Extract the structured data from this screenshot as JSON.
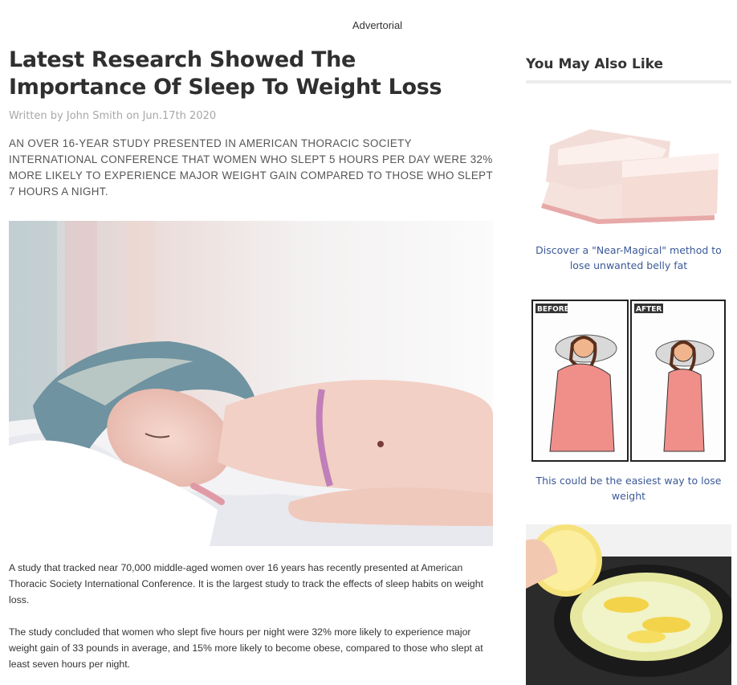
{
  "advertorial_label": "Advertorial",
  "article": {
    "title": "Latest Research Showed The Importance Of Sleep To Weight Loss",
    "byline": "Written by John Smith on Jun.17th 2020",
    "dek": "An over 16-year study presented in American Thoracic Society International Conference that women who slept 5 hours per day were 32% more likely to experience major weight gain compared to those who slept 7 hours a night.",
    "hero_image": "sleeping-woman-photo",
    "paragraphs": [
      "A study that tracked near 70,000 middle-aged women over 16 years has recently presented at American Thoracic Society International Conference. It is the largest study to track the effects of sleep habits on weight loss.",
      "The study concluded that women who slept five hours per night were 32% more likely to experience major weight gain of 33 pounds in average, and 15% more likely to become obese, compared to those who slept at least seven hours per night."
    ]
  },
  "sidebar": {
    "heading": "You May Also Like",
    "cards": [
      {
        "image": "belly-fat-slab-photo",
        "link_text": "Discover a \"Near-Magical\" method to lose unwanted belly fat"
      },
      {
        "image": "before-after-comic",
        "before_label": "BEFORE",
        "after_label": "AFTER",
        "link_text": "This could be the easiest way to lose weight"
      },
      {
        "image": "lemon-boiling-pot-photo",
        "link_text": ""
      }
    ]
  },
  "colors": {
    "link": "#3b5998",
    "title": "#2f2f2f",
    "byline": "#a7a7a7"
  }
}
